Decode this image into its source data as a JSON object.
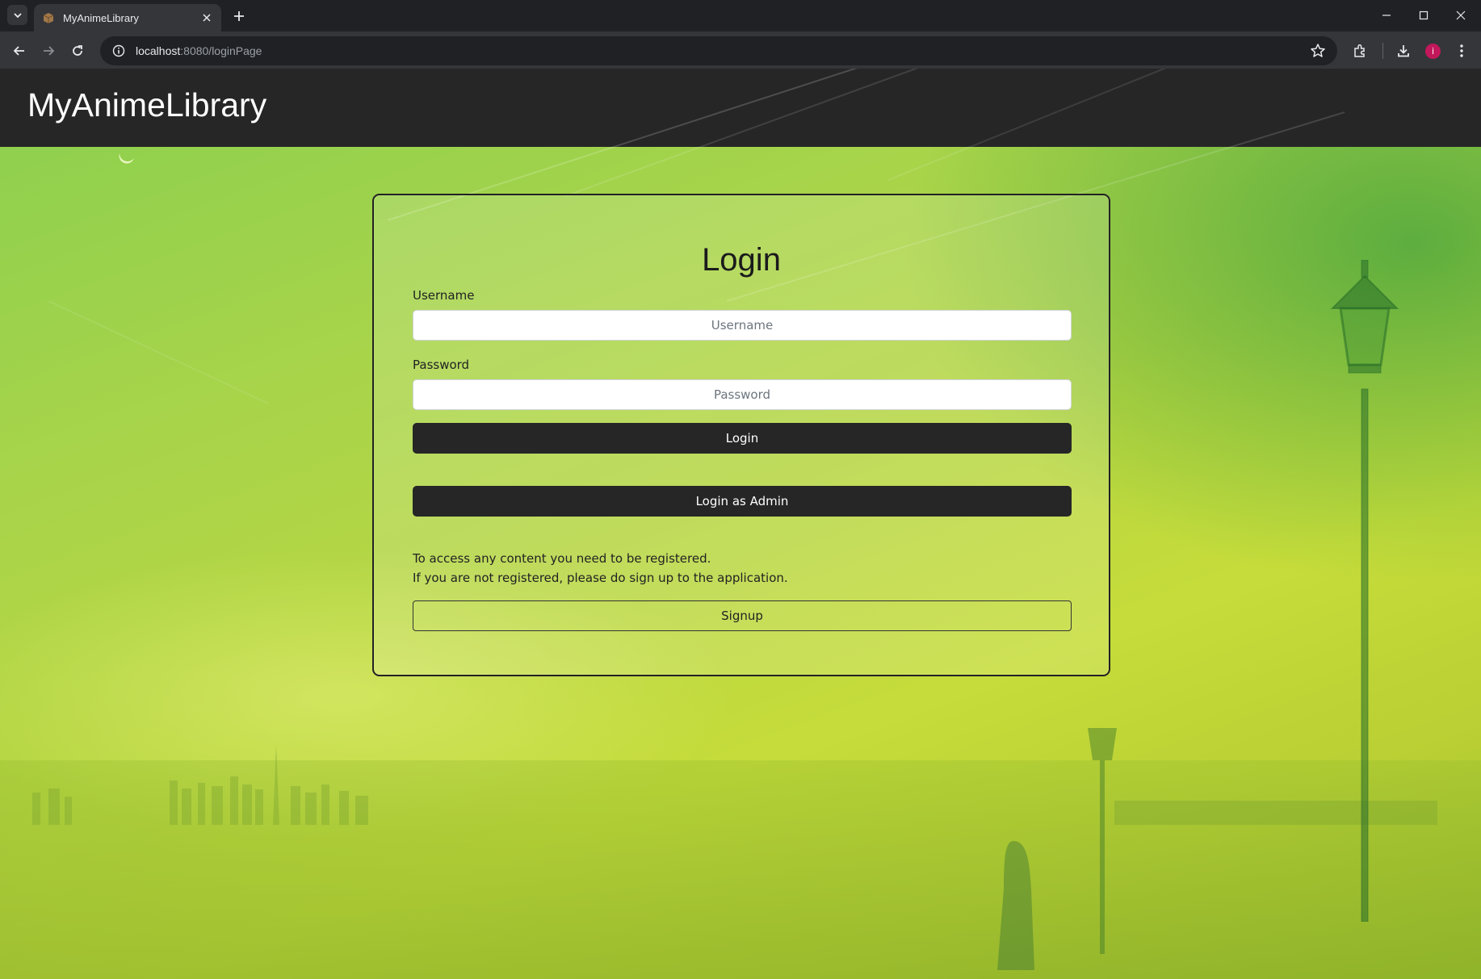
{
  "browser": {
    "tab_title": "MyAnimeLibrary",
    "url_host": "localhost",
    "url_rest": ":8080/loginPage",
    "profile_initial": "i"
  },
  "navbar": {
    "brand": "MyAnimeLibrary"
  },
  "login": {
    "title": "Login",
    "username_label": "Username",
    "username_placeholder": "Username",
    "username_value": "",
    "password_label": "Password",
    "password_placeholder": "Password",
    "password_value": "",
    "login_button": "Login",
    "admin_button": "Login as Admin",
    "info_line1": "To access any content you need to be registered.",
    "info_line2": "If you are not registered, please do sign up to the application.",
    "signup_button": "Signup"
  },
  "colors": {
    "navbar_bg": "#262626",
    "button_dark": "#262626",
    "bg_green": "#8fd04e",
    "bg_yellow": "#c6dc3a"
  },
  "icons": [
    "tab-search-icon",
    "favicon-icon",
    "close-icon",
    "plus-icon",
    "minimize-icon",
    "maximize-icon",
    "window-close-icon",
    "back-icon",
    "forward-icon",
    "reload-icon",
    "site-info-icon",
    "star-icon",
    "extensions-icon",
    "download-icon",
    "menu-icon"
  ]
}
